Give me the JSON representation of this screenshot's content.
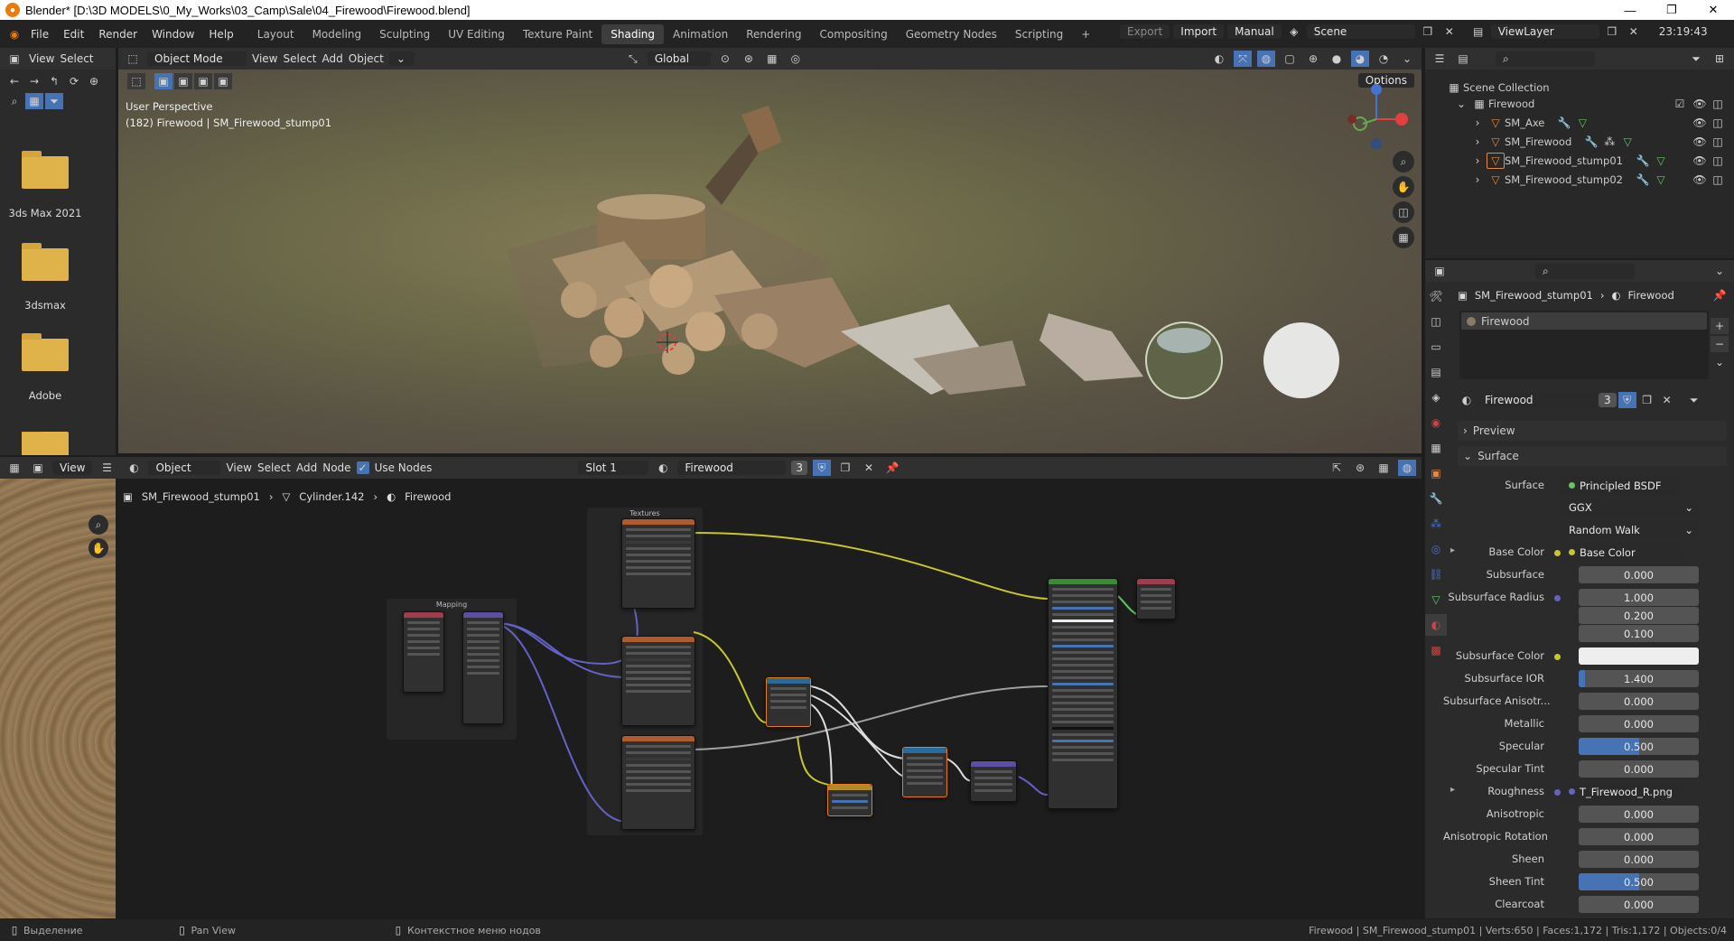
{
  "window": {
    "title": "Blender* [D:\\3D MODELS\\0_My_Works\\03_Camp\\Sale\\04_Firewood\\Firewood.blend]",
    "controls": [
      "—",
      "❐",
      "✕"
    ]
  },
  "menu": [
    "File",
    "Edit",
    "Render",
    "Window",
    "Help"
  ],
  "workspaces": [
    "Layout",
    "Modeling",
    "Sculpting",
    "UV Editing",
    "Texture Paint",
    "Shading",
    "Animation",
    "Rendering",
    "Compositing",
    "Geometry Nodes",
    "Scripting"
  ],
  "active_workspace": "Shading",
  "topbar_right": {
    "export": "Export",
    "import": "Import",
    "manual": "Manual",
    "scene": "Scene",
    "view_layer": "ViewLayer",
    "clock": "23:19:43"
  },
  "filebrowser": {
    "header": {
      "view": "View",
      "select": "Select"
    },
    "items": [
      "3ds Max 2021",
      "3dsmax",
      "Adobe"
    ]
  },
  "viewport": {
    "mode": "Object Mode",
    "menus": [
      "View",
      "Select",
      "Add",
      "Object"
    ],
    "orientation": "Global",
    "options": "Options",
    "overlay_title": "User Perspective",
    "overlay_sub": "(182) Firewood | SM_Firewood_stump01"
  },
  "node_editor": {
    "header": {
      "view": "View",
      "object": "Object",
      "menus": [
        "View",
        "Select",
        "Add",
        "Node"
      ],
      "use_nodes": "Use Nodes",
      "slot": "Slot 1",
      "material": "Firewood",
      "users": "3"
    },
    "breadcrumb": [
      "SM_Firewood_stump01",
      "Cylinder.142",
      "Firewood"
    ],
    "frames": {
      "mapping": "Mapping",
      "textures": "Textures"
    }
  },
  "outliner": {
    "title": "Scene Collection",
    "collection": "Firewood",
    "items": [
      "SM_Axe",
      "SM_Firewood",
      "SM_Firewood_stump01",
      "SM_Firewood_stump02"
    ]
  },
  "properties": {
    "breadcrumb": [
      "SM_Firewood_stump01",
      "Firewood"
    ],
    "slot": "Firewood",
    "material": "Firewood",
    "users": "3",
    "sections": {
      "preview": "Preview",
      "surface": "Surface"
    },
    "surface_label": "Surface",
    "surface_value": "Principled BSDF",
    "distribution": "GGX",
    "subsurface_method": "Random Walk",
    "rows": [
      {
        "label": "Base Color",
        "value": "Base Color",
        "kind": "link",
        "dot": "#c7c729"
      },
      {
        "label": "Subsurface",
        "value": "0.000",
        "kind": "num"
      },
      {
        "label": "Subsurface Radius",
        "value": "1.000",
        "kind": "num",
        "dot": "#6363c7"
      },
      {
        "label": "",
        "value": "0.200",
        "kind": "num"
      },
      {
        "label": "",
        "value": "0.100",
        "kind": "num"
      },
      {
        "label": "Subsurface Color",
        "value": "",
        "kind": "color",
        "dot": "#c7c729"
      },
      {
        "label": "Subsurface IOR",
        "value": "1.400",
        "kind": "num",
        "fill": 0.05
      },
      {
        "label": "Subsurface Anisotr...",
        "value": "0.000",
        "kind": "num"
      },
      {
        "label": "Metallic",
        "value": "0.000",
        "kind": "num"
      },
      {
        "label": "Specular",
        "value": "0.500",
        "kind": "num",
        "fill": 0.5
      },
      {
        "label": "Specular Tint",
        "value": "0.000",
        "kind": "num"
      },
      {
        "label": "Roughness",
        "value": "T_Firewood_R.png",
        "kind": "link",
        "dot": "#6363c7"
      },
      {
        "label": "Anisotropic",
        "value": "0.000",
        "kind": "num"
      },
      {
        "label": "Anisotropic Rotation",
        "value": "0.000",
        "kind": "num"
      },
      {
        "label": "Sheen",
        "value": "0.000",
        "kind": "num"
      },
      {
        "label": "Sheen Tint",
        "value": "0.500",
        "kind": "num",
        "fill": 0.5
      },
      {
        "label": "Clearcoat",
        "value": "0.000",
        "kind": "num"
      }
    ]
  },
  "statusbar": {
    "left": "Выделение",
    "mid": "Pan View",
    "ctx": "Контекстное меню нодов",
    "right": "Firewood | SM_Firewood_stump01 | Verts:650 | Faces:1,172 | Tris:1,172 | Objects:0/4"
  },
  "colors": {
    "accent": "#4772b3",
    "workspace_active": "#3d3d3d",
    "folder": "#e0b24a",
    "mesh_icon": "#e8883a"
  }
}
